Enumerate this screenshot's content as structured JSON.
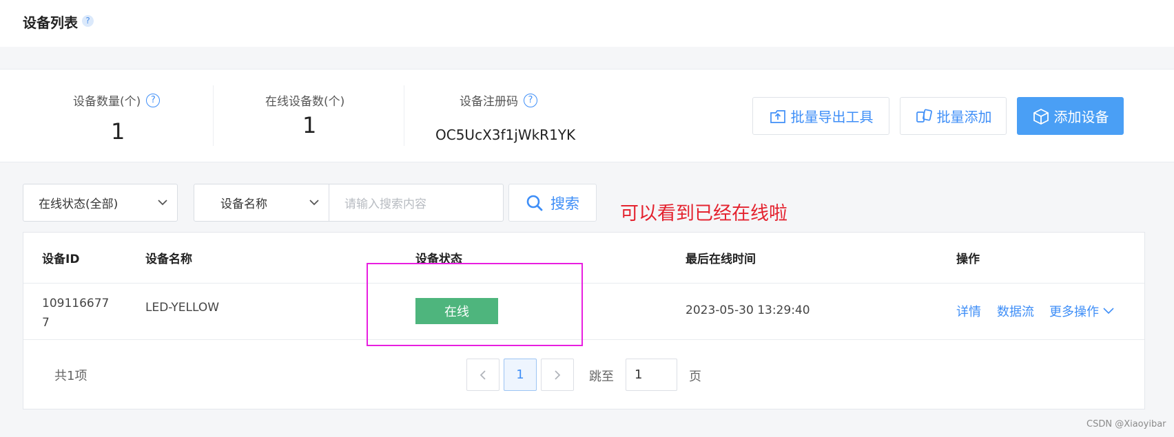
{
  "header": {
    "title": "设备列表",
    "help": "?"
  },
  "stats": {
    "device_count_label": "设备数量(个)",
    "device_count_value": "1",
    "online_count_label": "在线设备数(个)",
    "online_count_value": "1",
    "reg_code_label": "设备注册码",
    "reg_code_value": "OC5UcX3f1jWkR1YK",
    "help": "?"
  },
  "actions": {
    "export_label": "批量导出工具",
    "batch_add_label": "批量添加",
    "add_device_label": "添加设备"
  },
  "filters": {
    "status_select": "在线状态(全部)",
    "field_select": "设备名称",
    "search_placeholder": "请输入搜索内容",
    "search_button": "搜索"
  },
  "annotation": "可以看到已经在线啦",
  "table": {
    "columns": [
      "设备ID",
      "设备名称",
      "设备状态",
      "最后在线时间",
      "操作"
    ],
    "rows": [
      {
        "id_line1": "109116677",
        "id_line2": "7",
        "name": "LED-YELLOW",
        "status": "在线",
        "last_online": "2023-05-30 13:29:40",
        "actions": [
          "详情",
          "数据流",
          "更多操作"
        ]
      }
    ]
  },
  "pagination": {
    "total": "共1项",
    "current_page": "1",
    "jump_label": "跳至",
    "jump_value": "1",
    "page_unit": "页"
  },
  "watermark": "CSDN @Xiaoyibar",
  "colors": {
    "accent": "#3e8ef7",
    "primary_button": "#4a9ff5",
    "online_status": "#4eb57d",
    "annotation": "#e4232f",
    "highlight_box": "#e81ee0"
  }
}
